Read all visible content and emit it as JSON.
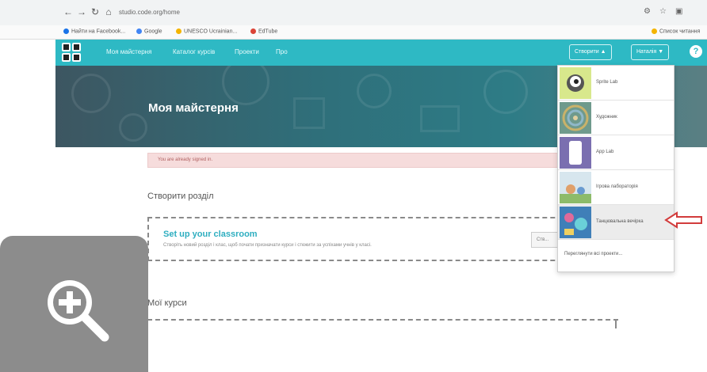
{
  "browser": {
    "url": "studio.code.org/home",
    "bookmarks": [
      "Найти на Facebook...",
      "Google",
      "UNESCO Ucrainian...",
      "EdTube"
    ],
    "bookmark_colors": [
      "#1a73e8",
      "#4285f4",
      "#f4b400",
      "#db4437"
    ],
    "reading_list": "Список читання"
  },
  "header": {
    "nav": [
      "Моя майстерня",
      "Каталог курсів",
      "Проекти",
      "Про"
    ],
    "create_button": "Створити ▲",
    "user_button": "Наталія ▼",
    "help_icon": "?",
    "accent_color": "#2eb9c4"
  },
  "banner": {
    "title": "Моя майстерня"
  },
  "alert": {
    "text": "You are already signed in."
  },
  "create_section": {
    "title": "Створити розділ",
    "setup_title": "Set up your classroom",
    "setup_desc": "Створіть новий розділ і клас, щоб почати призначати курси і стежити за успіхами учнів у класі.",
    "setup_button": "Ств..."
  },
  "courses_section": {
    "title": "Мої курси"
  },
  "dropdown": {
    "items": [
      {
        "label": "Sprite Lab",
        "icon": "sprite-lab-thumbnail"
      },
      {
        "label": "Художник",
        "icon": "artist-thumbnail"
      },
      {
        "label": "App Lab",
        "icon": "app-lab-thumbnail"
      },
      {
        "label": "Ігрова лабораторія",
        "icon": "game-lab-thumbnail"
      },
      {
        "label": "Танцювальна вечірка",
        "icon": "dance-party-thumbnail"
      }
    ],
    "view_all": "Переглянути всі проекти...",
    "arrow_color": "#d23c3c"
  }
}
